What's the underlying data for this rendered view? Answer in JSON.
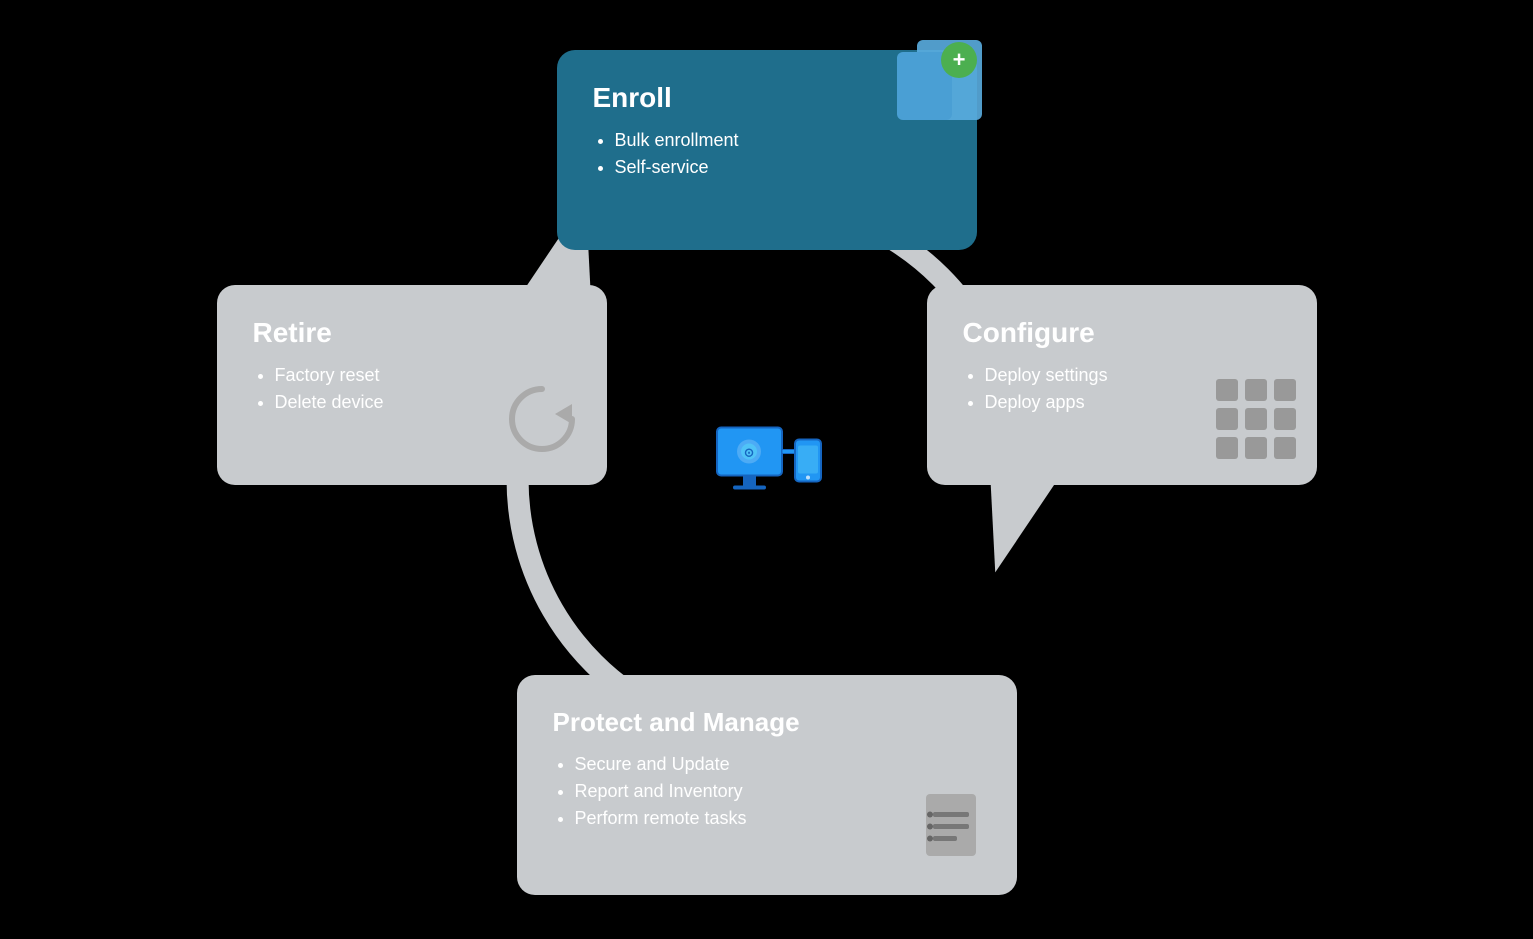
{
  "cards": {
    "enroll": {
      "title": "Enroll",
      "items": [
        "Bulk enrollment",
        "Self-service"
      ]
    },
    "configure": {
      "title": "Configure",
      "items": [
        "Deploy settings",
        "Deploy apps"
      ]
    },
    "retire": {
      "title": "Retire",
      "items": [
        "Factory reset",
        "Delete device"
      ]
    },
    "protect": {
      "title": "Protect and Manage",
      "items": [
        "Secure and Update",
        "Report and Inventory",
        "Perform remote tasks"
      ]
    }
  },
  "colors": {
    "enroll_bg": "#1f6e8c",
    "other_bg": "#c0c3c6",
    "arrow_color": "#d0d4d8",
    "text_light": "#ffffff",
    "text_dark": "#ffffff"
  }
}
